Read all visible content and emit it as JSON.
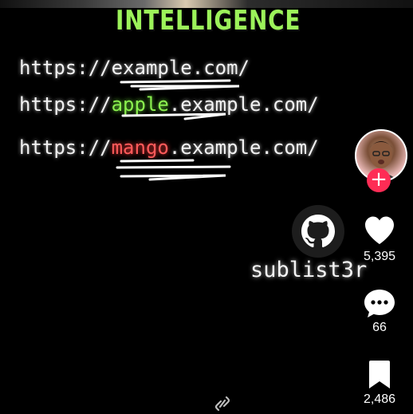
{
  "headline": "INTELLIGENCE",
  "urls": {
    "line1": "https://example.com/",
    "line2": {
      "prefix": "https://",
      "sub": "apple",
      "suffix": ".example.com/"
    },
    "line3": {
      "prefix": "https://",
      "sub": "mango",
      "suffix": ".example.com/"
    }
  },
  "creator": {
    "handle": "sublist3r",
    "logo_icon": "github-octocat-icon"
  },
  "actions": {
    "like_count": "5,395",
    "comment_count": "66",
    "bookmark_count": "2,486"
  },
  "colors": {
    "headline": "#9cf25a",
    "apple_highlight": "#8bf04f",
    "mango_highlight": "#ff5b5b",
    "follow_button": "#fe2c55"
  }
}
